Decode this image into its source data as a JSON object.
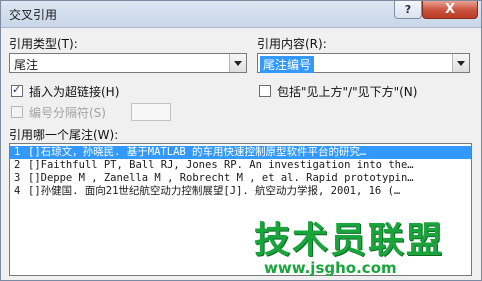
{
  "dialog": {
    "title": "交叉引用",
    "help_label": "?",
    "close_label": "X"
  },
  "reference_type": {
    "label": "引用类型(T):",
    "value": "尾注"
  },
  "reference_content": {
    "label": "引用内容(R):",
    "value": "尾注编号"
  },
  "insert_hyperlink": {
    "label": "插入为超链接(H)",
    "checked": true
  },
  "include_above_below": {
    "label": "包括\"见上方\"/\"见下方\"(N)",
    "checked": false
  },
  "number_separator": {
    "label": "编号分隔符(S)",
    "enabled": false
  },
  "list": {
    "label": "引用哪一个尾注(W):",
    "items": [
      {
        "num": "1",
        "text": "[]石琼文，孙晓民. 基于MATLAB 的车用快速控制原型软件平台的研究…",
        "selected": true
      },
      {
        "num": "2",
        "text": "[]Faithfull PT, Ball RJ, Jones RP. An investigation into the…",
        "selected": false
      },
      {
        "num": "3",
        "text": "[]Deppe M , Zanella M , Robrecht M , et al. Rapid prototypin…",
        "selected": false
      },
      {
        "num": "4",
        "text": "[]孙健国. 面向21世纪航空动力控制展望[J]. 航空动力学报, 2001, 16 (…",
        "selected": false
      }
    ]
  },
  "watermark": {
    "brand": "技术员联盟",
    "url": "www.jsgho.com"
  }
}
